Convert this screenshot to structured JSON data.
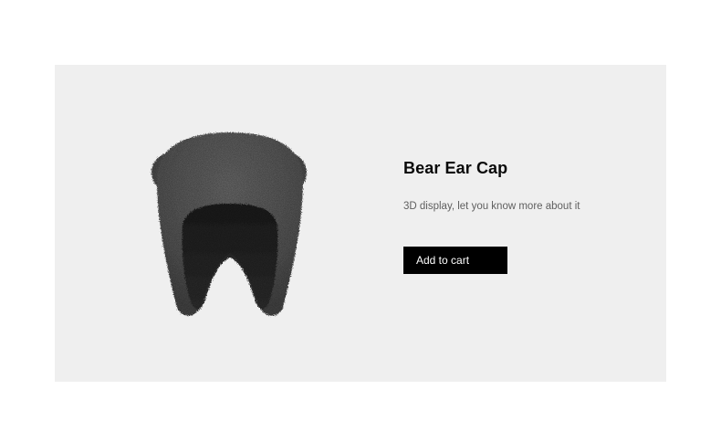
{
  "product": {
    "name": "Bear Ear Cap",
    "description": "3D display, let you know more about it",
    "add_to_cart_label": "Add to cart",
    "image_icon": "bear-ear-cap-3d-model"
  },
  "colors": {
    "card_background": "#efefef",
    "button_background": "#000000",
    "button_text": "#ffffff",
    "cap_fur": "#555555"
  }
}
